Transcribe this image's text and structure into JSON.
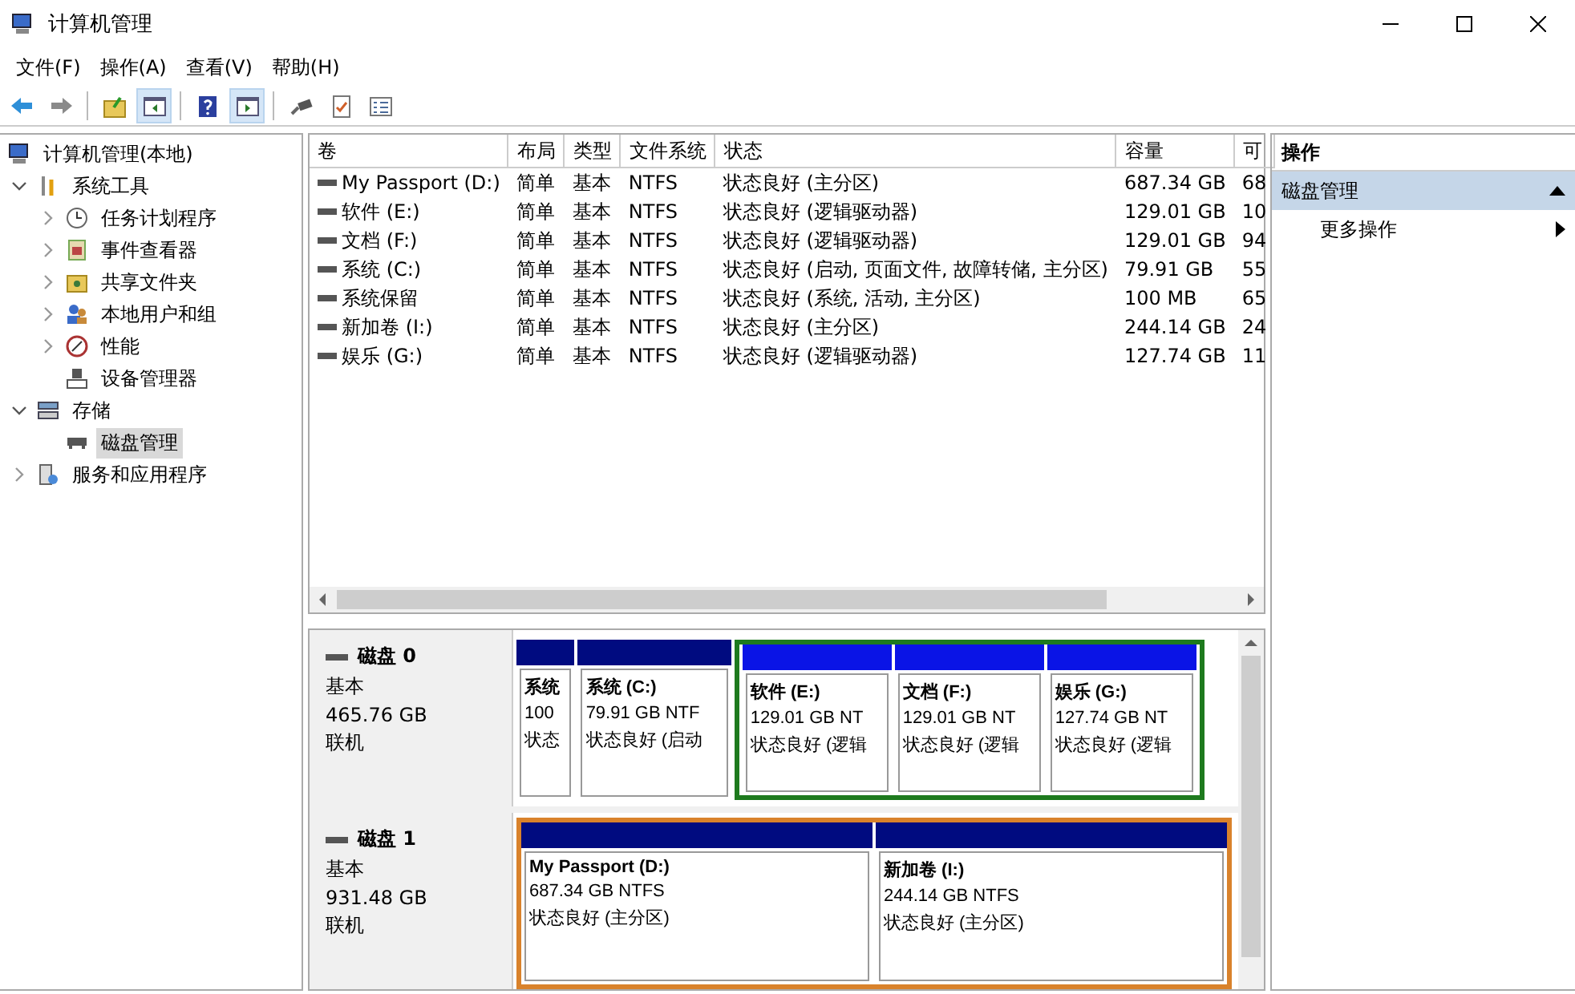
{
  "window": {
    "title": "计算机管理"
  },
  "menu": [
    "文件(F)",
    "操作(A)",
    "查看(V)",
    "帮助(H)"
  ],
  "toolbar": [
    {
      "pressed": false
    },
    {
      "pressed": false
    },
    {
      "pressed": false
    },
    {
      "pressed": true
    },
    {
      "pressed": false
    },
    {
      "pressed": true
    },
    {
      "pressed": false
    },
    {
      "pressed": false
    },
    {
      "pressed": false
    }
  ],
  "tree": [
    {
      "label": "计算机管理(本地)",
      "selected": false,
      "children": [
        {
          "label": "系统工具",
          "selected": false,
          "expanded": true,
          "children": [
            {
              "label": "任务计划程序",
              "selected": false,
              "expanded": false
            },
            {
              "label": "事件查看器",
              "selected": false,
              "expanded": false
            },
            {
              "label": "共享文件夹",
              "selected": false,
              "expanded": false
            },
            {
              "label": "本地用户和组",
              "selected": false,
              "expanded": false
            },
            {
              "label": "性能",
              "selected": false,
              "expanded": false
            },
            {
              "label": "设备管理器",
              "selected": false
            }
          ]
        },
        {
          "label": "存储",
          "selected": false,
          "expanded": true,
          "children": [
            {
              "label": "磁盘管理",
              "selected": true
            }
          ]
        },
        {
          "label": "服务和应用程序",
          "selected": false,
          "expanded": false
        }
      ]
    }
  ],
  "table": {
    "columns": [
      "卷",
      "布局",
      "类型",
      "文件系统",
      "状态",
      "容量",
      "可"
    ],
    "rows": [
      {
        "selected": false,
        "cells": [
          "My Passport (D:)",
          "简单",
          "基本",
          "NTFS",
          "状态良好 (主分区)",
          "687.34 GB",
          "68"
        ]
      },
      {
        "selected": false,
        "cells": [
          "软件 (E:)",
          "简单",
          "基本",
          "NTFS",
          "状态良好 (逻辑驱动器)",
          "129.01 GB",
          "10"
        ]
      },
      {
        "selected": false,
        "cells": [
          "文档 (F:)",
          "简单",
          "基本",
          "NTFS",
          "状态良好 (逻辑驱动器)",
          "129.01 GB",
          "94"
        ]
      },
      {
        "selected": false,
        "cells": [
          "系统 (C:)",
          "简单",
          "基本",
          "NTFS",
          "状态良好 (启动, 页面文件, 故障转储, 主分区)",
          "79.91 GB",
          "55"
        ]
      },
      {
        "selected": false,
        "cells": [
          "系统保留",
          "简单",
          "基本",
          "NTFS",
          "状态良好 (系统, 活动, 主分区)",
          "100 MB",
          "65"
        ]
      },
      {
        "selected": false,
        "cells": [
          "新加卷 (I:)",
          "简单",
          "基本",
          "NTFS",
          "状态良好 (主分区)",
          "244.14 GB",
          "24"
        ]
      },
      {
        "selected": false,
        "cells": [
          "娱乐 (G:)",
          "简单",
          "基本",
          "NTFS",
          "状态良好 (逻辑驱动器)",
          "127.74 GB",
          "11"
        ]
      }
    ]
  },
  "disks": [
    {
      "name": "磁盘 0",
      "type": "基本",
      "size": "465.76 GB",
      "status": "联机",
      "highlighted": false,
      "partitions": [
        {
          "kind": "primary",
          "name": "系统",
          "size": "100",
          "status": "状态"
        },
        {
          "kind": "primary",
          "name": "系统 (C:)",
          "size": "79.91 GB NTF",
          "status": "状态良好 (启动"
        },
        {
          "kind": "extended",
          "partitions": [
            {
              "kind": "logical",
              "name": "软件 (E:)",
              "size": "129.01 GB NT",
              "status": "状态良好 (逻辑"
            },
            {
              "kind": "logical",
              "name": "文档 (F:)",
              "size": "129.01 GB NT",
              "status": "状态良好 (逻辑"
            },
            {
              "kind": "logical",
              "name": "娱乐 (G:)",
              "size": "127.74 GB NT",
              "status": "状态良好 (逻辑"
            }
          ]
        }
      ]
    },
    {
      "name": "磁盘 1",
      "type": "基本",
      "size": "931.48 GB",
      "status": "联机",
      "highlighted": true,
      "partitions": [
        {
          "kind": "primary",
          "name": "My Passport (D:)",
          "size": "687.34 GB NTFS",
          "status": "状态良好 (主分区)"
        },
        {
          "kind": "primary",
          "name": "新加卷 (I:)",
          "size": "244.14 GB NTFS",
          "status": "状态良好 (主分区)"
        }
      ]
    }
  ],
  "actions": {
    "title": "操作",
    "sections": [
      {
        "label": "磁盘管理",
        "expanded": true,
        "items": [
          "更多操作"
        ]
      }
    ]
  }
}
